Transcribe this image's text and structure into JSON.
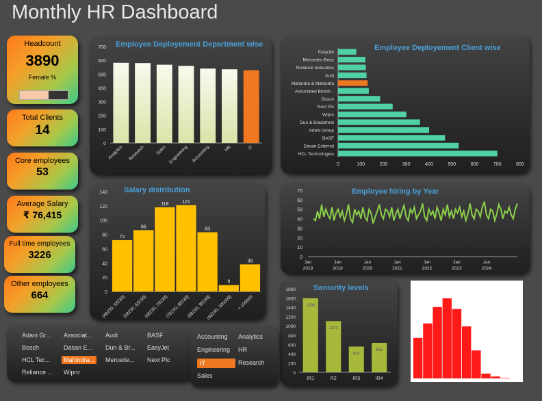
{
  "title": "Monthly HR Dashboard",
  "colors": {
    "accent": "#f07820",
    "bar_cream": "#eef2cc",
    "bar_teal": "#4fd1a5",
    "bar_yellow": "#ffc000",
    "bar_olive": "#a8b83a",
    "line_green": "#8ccf4a",
    "hist_red": "#ff1a1a"
  },
  "kpis": {
    "headcount": {
      "label": "Headcount",
      "value": "3890",
      "sublabel": "Female %",
      "female_share": 0.6
    },
    "clients": {
      "label": "Total Clients",
      "value": "14"
    },
    "core": {
      "label": "Core employees",
      "value": "53"
    },
    "salary": {
      "label": "Average Salary",
      "value": "₹ 76,415"
    },
    "fulltime": {
      "label": "Full time employees",
      "value": "3226"
    },
    "other": {
      "label": "Other employees",
      "value": "664"
    }
  },
  "chart_data": [
    {
      "id": "dept",
      "type": "bar",
      "title": "Employee Deployement Department wise",
      "categories": [
        "Analytics",
        "Research",
        "Sales",
        "Engineering",
        "Accounting",
        "HR",
        "IT"
      ],
      "values": [
        582,
        580,
        568,
        560,
        540,
        535,
        528
      ],
      "highlight": "IT",
      "ylim": [
        0,
        700
      ],
      "yticks": [
        0,
        100,
        200,
        300,
        400,
        500,
        600,
        700
      ]
    },
    {
      "id": "client",
      "type": "bar",
      "orientation": "horizontal",
      "title": "Employee Deployement Client wise",
      "categories": [
        "EasyJet",
        "Mercedes-Benz",
        "Reliance Industries",
        "Audi",
        "Mahindra & Mahindra",
        "Associated British...",
        "Bosch",
        "Next Plc",
        "Wipro",
        "Dun & Bradstreet",
        "Adani Group",
        "BASF",
        "Dasan External",
        "HCL Technologies"
      ],
      "values": [
        80,
        120,
        122,
        125,
        130,
        135,
        185,
        240,
        300,
        360,
        400,
        470,
        530,
        700
      ],
      "highlight": "Mahindra & Mahindra",
      "xlim": [
        0,
        800
      ],
      "xticks": [
        0,
        100,
        200,
        300,
        400,
        500,
        600,
        700,
        800
      ]
    },
    {
      "id": "salary",
      "type": "bar",
      "title": "Salary distribution",
      "categories": [
        "[48230, 58230]",
        "(58230, 68230]",
        "(68230, 78230]",
        "(78230, 88230]",
        "(88230, 98230]",
        "(98230, 100000]",
        "> 100000"
      ],
      "values": [
        72,
        86,
        118,
        121,
        83,
        9,
        38
      ],
      "ylim": [
        0,
        140
      ],
      "yticks": [
        0,
        20,
        40,
        60,
        80,
        100,
        120,
        140
      ]
    },
    {
      "id": "hiring",
      "type": "line",
      "title": "Employee hiring by Year",
      "ylim": [
        0,
        70
      ],
      "yticks": [
        0,
        10,
        20,
        30,
        40,
        50,
        60,
        70
      ],
      "xticks": [
        {
          "top": "Jan",
          "bottom": "2018"
        },
        {
          "top": "Jan",
          "bottom": "2019"
        },
        {
          "top": "Jan",
          "bottom": "2020"
        },
        {
          "top": "Jan",
          "bottom": "2021"
        },
        {
          "top": "Jan",
          "bottom": "2022"
        },
        {
          "top": "Jan",
          "bottom": "2023"
        },
        {
          "top": "Jan",
          "bottom": "2024"
        }
      ],
      "values": [
        40,
        38,
        48,
        40,
        55,
        42,
        50,
        44,
        40,
        52,
        38,
        46,
        50,
        42,
        48,
        38,
        45,
        55,
        40,
        36,
        50,
        44,
        48,
        40,
        52,
        42,
        38,
        50,
        46,
        35,
        42,
        48,
        55,
        44,
        40,
        50,
        48,
        42,
        52,
        38,
        45,
        50,
        40,
        48,
        54,
        42,
        38,
        50,
        46,
        52,
        40,
        44,
        48,
        56,
        42,
        38,
        50,
        44,
        48,
        40,
        52,
        46,
        38,
        50,
        44,
        55,
        42,
        48,
        40,
        50,
        46,
        52,
        42,
        48,
        38,
        45,
        56,
        44,
        40,
        50,
        48,
        42,
        52,
        58,
        44,
        40,
        50,
        48,
        38,
        45,
        55,
        50,
        40,
        48,
        46,
        52,
        44,
        40,
        50,
        56
      ]
    },
    {
      "id": "seniority",
      "type": "bar",
      "title": "Seniority levels",
      "categories": [
        "IR1",
        "R2",
        "IR3",
        "IR4"
      ],
      "values": [
        1596,
        1103,
        554,
        635
      ],
      "ylim": [
        0,
        1800
      ],
      "yticks": [
        0,
        200,
        400,
        600,
        800,
        1000,
        1200,
        1400,
        1600,
        1800
      ]
    },
    {
      "id": "hist",
      "type": "bar",
      "values": [
        0.42,
        0.57,
        0.74,
        0.83,
        0.72,
        0.54,
        0.29,
        0.05,
        0.02,
        0.005
      ]
    }
  ],
  "slicer_clients": {
    "items": [
      "Adani Gr...",
      "Associat...",
      "Audi",
      "BASF",
      "Bosch",
      "Dasan E...",
      "Dun & Br...",
      "EasyJet",
      "HCL Tec...",
      "Mahindra...",
      "Mercede...",
      "Next Plc",
      "Reliance ...",
      "Wipro"
    ],
    "selected": "Mahindra..."
  },
  "slicer_departments": {
    "items": [
      "Accounting",
      "Analytics",
      "Engineering",
      "HR",
      "IT",
      "Research",
      "Sales"
    ],
    "selected": "IT"
  }
}
